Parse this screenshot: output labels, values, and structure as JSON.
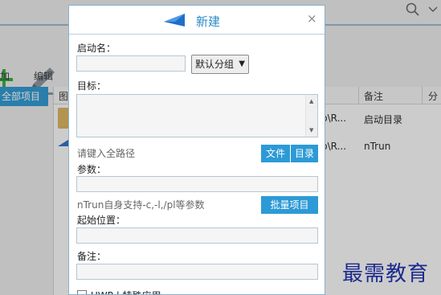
{
  "background": {
    "toolbar": {
      "add_label": "加",
      "edit_label": "编辑"
    },
    "sidebar": {
      "selected_item": "全部项目"
    },
    "grid": {
      "columns": [
        "图",
        "备注",
        "分组"
      ],
      "rows": [
        {
          "path_fragment": "p\\R...",
          "note": "启动目录"
        },
        {
          "path_fragment": "p\\R...",
          "note": "nTrun"
        }
      ]
    }
  },
  "dialog": {
    "title": "新建",
    "close_glyph": "×",
    "name_label": "启动名：",
    "group_value": "默认分组",
    "target_label": "目标：",
    "path_hint": "请键入全路径",
    "file_button": "文件",
    "dir_button": "目录",
    "params_label": "参数：",
    "params_hint": "nTrun自身支持-c,-l,/pl等参数",
    "batch_button": "批量项目",
    "start_pos_label": "起始位置：",
    "note_label": "备注：",
    "uwp_label": "UWP | 特殊应用"
  },
  "watermark": "最需教育",
  "colors": {
    "accent": "#2c9ad6",
    "title": "#2b8ac6",
    "selection": "#2b97d0",
    "watermark": "#1b2a8f"
  }
}
